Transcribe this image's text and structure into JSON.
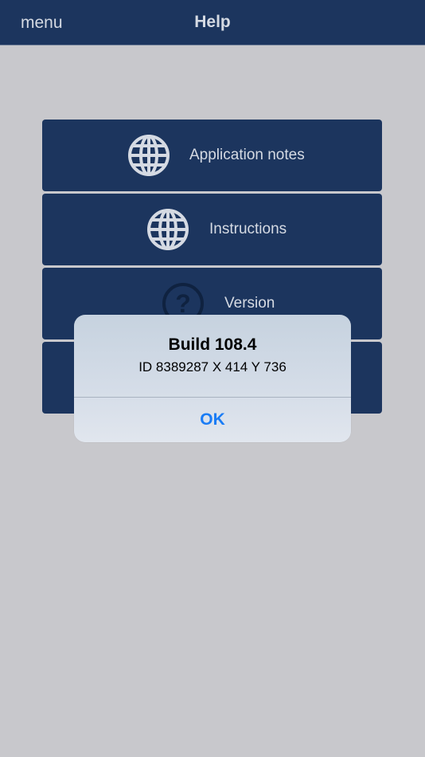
{
  "navbar": {
    "menu_label": "menu",
    "title": "Help"
  },
  "buttons": [
    {
      "label": "Application notes",
      "icon": "globe-icon"
    },
    {
      "label": "Instructions",
      "icon": "globe-icon"
    },
    {
      "label": "Version",
      "icon": "question-icon"
    },
    {
      "label": "",
      "icon": ""
    }
  ],
  "alert": {
    "title": "Build 108.4",
    "message": "ID 8389287 X 414 Y 736",
    "ok_label": "OK"
  },
  "colors": {
    "navbar_bg": "#1c355e",
    "button_bg": "#1c355e",
    "page_bg": "#c8c8cc",
    "alert_action": "#1a7cf5",
    "icon_color": "#d5dae3"
  }
}
